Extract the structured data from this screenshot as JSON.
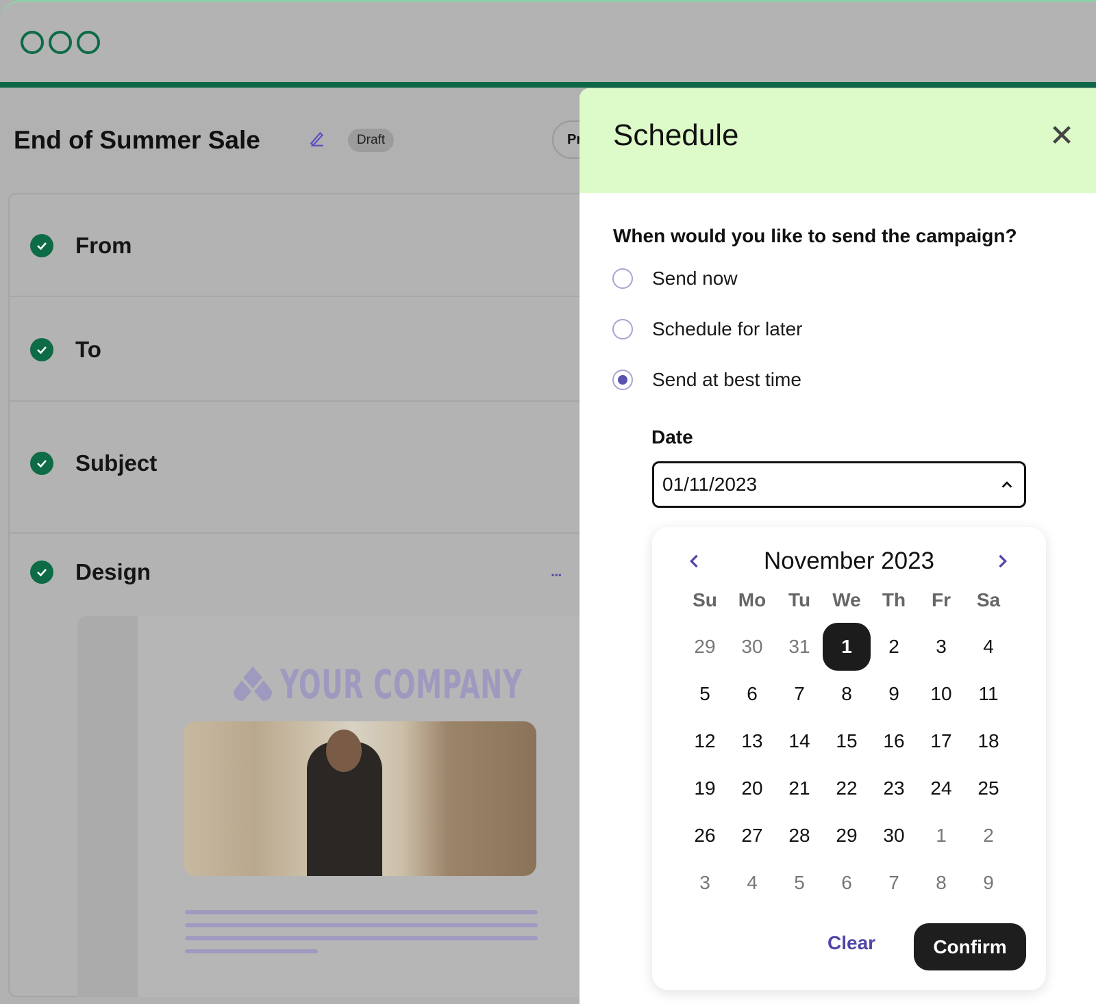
{
  "window": {
    "controls": [
      "circle",
      "circle",
      "circle"
    ],
    "accent": "#0d6645"
  },
  "campaign": {
    "title": "End of Summer Sale",
    "status": "Draft",
    "partial_button": "Pr"
  },
  "steps": [
    {
      "label": "From",
      "done": true
    },
    {
      "label": "To",
      "done": true
    },
    {
      "label": "Subject",
      "done": true
    },
    {
      "label": "Design",
      "done": true,
      "more": "..."
    }
  ],
  "design_preview": {
    "logo_text": "YOUR COMPANY"
  },
  "schedule": {
    "title": "Schedule",
    "question": "When would you like to send the campaign?",
    "options": [
      {
        "label": "Send now",
        "selected": false
      },
      {
        "label": "Schedule for later",
        "selected": false
      },
      {
        "label": "Send at best time",
        "selected": true
      }
    ],
    "date_label": "Date",
    "date_value": "01/11/2023",
    "header_color": "#dcfbc8",
    "calendar": {
      "month": "November 2023",
      "weekdays": [
        "Su",
        "Mo",
        "Tu",
        "We",
        "Th",
        "Fr",
        "Sa"
      ],
      "weeks": [
        [
          "29",
          "30",
          "31",
          "1",
          "2",
          "3",
          "4"
        ],
        [
          "5",
          "6",
          "7",
          "8",
          "9",
          "10",
          "11"
        ],
        [
          "12",
          "13",
          "14",
          "15",
          "16",
          "17",
          "18"
        ],
        [
          "19",
          "20",
          "21",
          "22",
          "23",
          "24",
          "25"
        ],
        [
          "26",
          "27",
          "28",
          "29",
          "30",
          "1",
          "2"
        ],
        [
          "3",
          "4",
          "5",
          "6",
          "7",
          "8",
          "9"
        ]
      ],
      "muted": [
        [
          0,
          0
        ],
        [
          0,
          1
        ],
        [
          0,
          2
        ],
        [
          4,
          5
        ],
        [
          4,
          6
        ],
        [
          5,
          0
        ],
        [
          5,
          1
        ],
        [
          5,
          2
        ],
        [
          5,
          3
        ],
        [
          5,
          4
        ],
        [
          5,
          5
        ],
        [
          5,
          6
        ]
      ],
      "selected": [
        0,
        3
      ],
      "clear_label": "Clear",
      "confirm_label": "Confirm"
    }
  }
}
